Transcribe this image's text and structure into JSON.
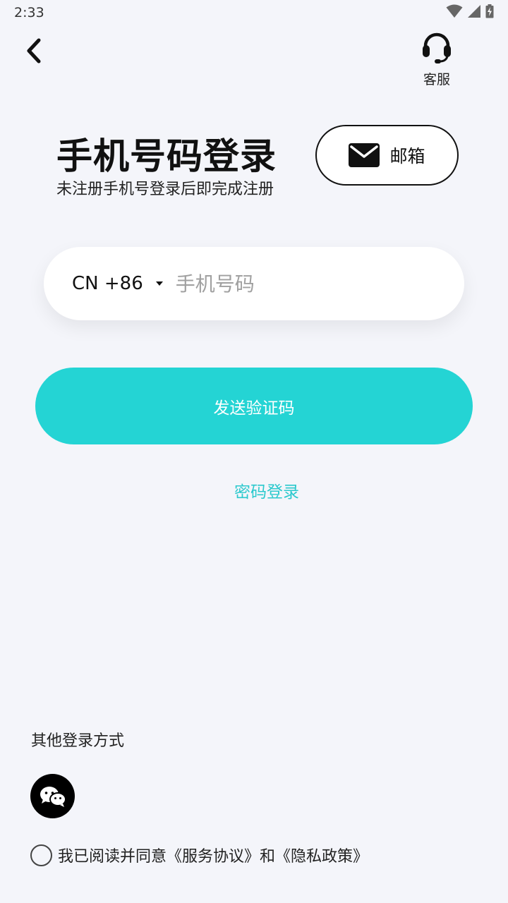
{
  "status_bar": {
    "time": "2:33"
  },
  "header": {
    "support_label": "客服"
  },
  "title": {
    "main": "手机号码登录",
    "subtitle": "未注册手机号登录后即完成注册"
  },
  "email_button": {
    "label": "邮箱"
  },
  "phone_form": {
    "country_code": "CN +86",
    "phone_placeholder": "手机号码",
    "phone_value": ""
  },
  "send_code_button": {
    "label": "发送验证码"
  },
  "password_login": {
    "label": "密码登录"
  },
  "other_login": {
    "title": "其他登录方式",
    "methods": [
      "wechat-icon"
    ]
  },
  "agreement": {
    "prefix": "我已阅读并同意",
    "service_link": "《服务协议》",
    "conjunction": "和",
    "privacy_link": "《隐私政策》",
    "checked": false
  },
  "colors": {
    "accent": "#24d4d4",
    "link": "#2bc9cd",
    "background": "#f4f5fa"
  }
}
